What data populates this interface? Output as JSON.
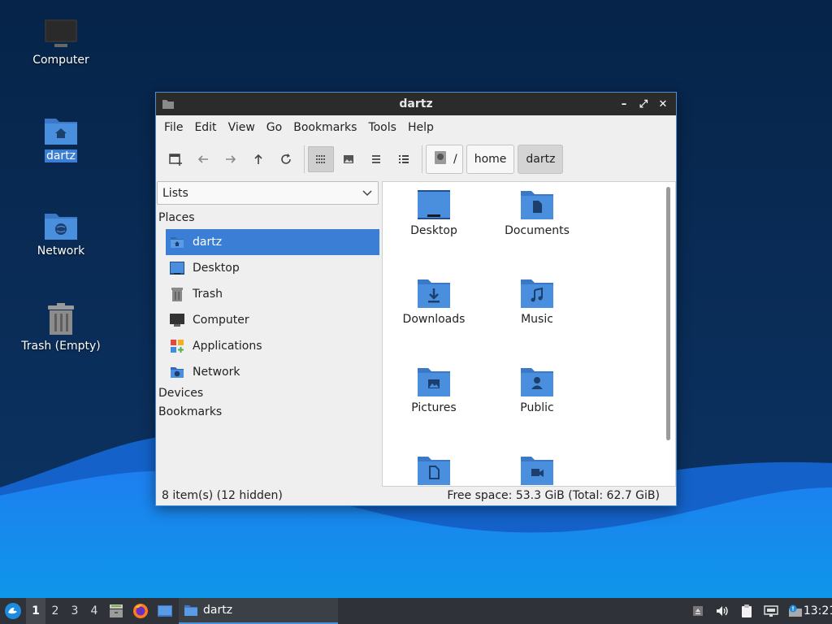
{
  "desktop": {
    "icons": [
      {
        "label": "Computer"
      },
      {
        "label": "dartz"
      },
      {
        "label": "Network"
      },
      {
        "label": "Trash (Empty)"
      }
    ]
  },
  "window": {
    "title": "dartz",
    "controls": {
      "minimize": "–",
      "maximize": "⤢",
      "close": "✕"
    }
  },
  "menubar": [
    "File",
    "Edit",
    "View",
    "Go",
    "Bookmarks",
    "Tools",
    "Help"
  ],
  "breadcrumb": {
    "root": "/",
    "parts": [
      "home",
      "dartz"
    ]
  },
  "sidebar": {
    "pane_selector": "Lists",
    "sections": {
      "places": "Places",
      "devices": "Devices",
      "bookmarks": "Bookmarks"
    },
    "places": [
      {
        "label": "dartz",
        "icon": "home-folder-icon"
      },
      {
        "label": "Desktop",
        "icon": "desktop-icon"
      },
      {
        "label": "Trash",
        "icon": "trash-icon"
      },
      {
        "label": "Computer",
        "icon": "computer-icon"
      },
      {
        "label": "Applications",
        "icon": "applications-icon"
      },
      {
        "label": "Network",
        "icon": "network-folder-icon"
      }
    ]
  },
  "files": [
    {
      "label": "Desktop",
      "icon": "desktop-folder-icon"
    },
    {
      "label": "Documents",
      "icon": "documents-folder-icon"
    },
    {
      "label": "Downloads",
      "icon": "downloads-folder-icon"
    },
    {
      "label": "Music",
      "icon": "music-folder-icon"
    },
    {
      "label": "Pictures",
      "icon": "pictures-folder-icon"
    },
    {
      "label": "Public",
      "icon": "public-folder-icon"
    },
    {
      "label": "",
      "icon": "templates-folder-icon"
    },
    {
      "label": "",
      "icon": "videos-folder-icon"
    }
  ],
  "statusbar": {
    "items": "8 item(s) (12 hidden)",
    "free_space": "Free space: 53.3 GiB (Total: 62.7 GiB)"
  },
  "taskbar": {
    "workspaces": [
      "1",
      "2",
      "3",
      "4"
    ],
    "active_workspace": "1",
    "task_title": "dartz",
    "clock": "13:21"
  },
  "colors": {
    "accent": "#3a7fd5",
    "folder": "#4a8fde",
    "taskbar": "#2f3339",
    "titlebar": "#2b2b2b"
  }
}
